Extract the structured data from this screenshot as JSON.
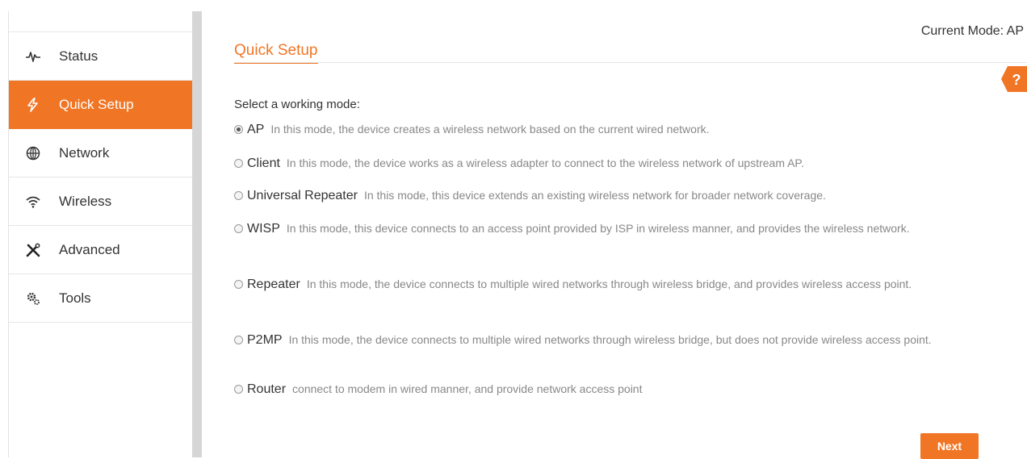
{
  "colors": {
    "accent": "#f07625"
  },
  "sidebar": {
    "items": [
      {
        "label": "Status",
        "icon": "pulse-icon",
        "active": false
      },
      {
        "label": "Quick Setup",
        "icon": "lightning-icon",
        "active": true
      },
      {
        "label": "Network",
        "icon": "globe-icon",
        "active": false
      },
      {
        "label": "Wireless",
        "icon": "wifi-icon",
        "active": false
      },
      {
        "label": "Advanced",
        "icon": "tools-icon",
        "active": false
      },
      {
        "label": "Tools",
        "icon": "gears-icon",
        "active": false
      }
    ]
  },
  "main": {
    "current_mode": "Current Mode: AP",
    "title": "Quick Setup",
    "help_label": "?",
    "select_label": "Select a working mode:",
    "modes": [
      {
        "name": "AP",
        "description": "In this mode, the device creates a wireless network based on the current wired network.",
        "checked": true
      },
      {
        "name": "Client",
        "description": "In this mode, the device works as a wireless adapter to connect to the wireless network of upstream AP.",
        "checked": false
      },
      {
        "name": "Universal Repeater",
        "description": "In this mode, this device extends an existing wireless network for broader network coverage.",
        "checked": false
      },
      {
        "name": "WISP",
        "description": "In this mode, this device connects to an access point provided by ISP in wireless manner, and provides the wireless network.",
        "checked": false
      },
      {
        "name": "Repeater",
        "description": "In this mode, the device connects to multiple wired networks through wireless bridge, and provides wireless access point.",
        "checked": false
      },
      {
        "name": "P2MP",
        "description": "In this mode, the device connects to multiple wired networks through wireless bridge, but does not provide wireless access point.",
        "checked": false
      },
      {
        "name": "Router",
        "description": "connect to modem in wired manner, and provide network access point",
        "checked": false
      }
    ],
    "next_label": "Next"
  }
}
